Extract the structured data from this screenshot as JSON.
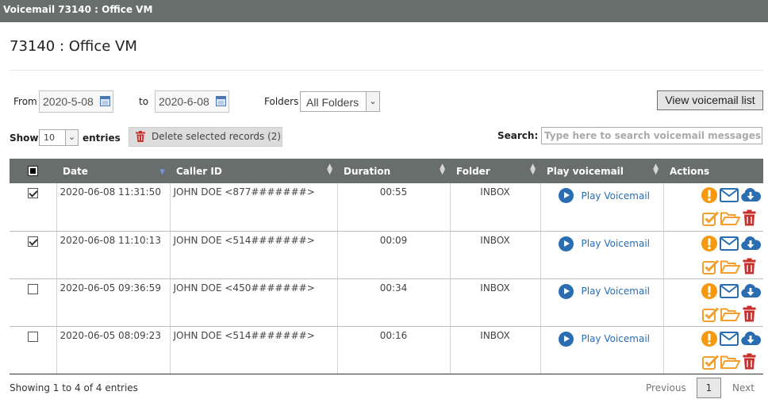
{
  "window": {
    "title": "Voicemail 73140 : Office VM"
  },
  "page": {
    "title": "73140 : Office VM"
  },
  "filters": {
    "from_label": "From",
    "from_value": "2020-5-08",
    "to_label": "to",
    "to_value": "2020-6-08",
    "folders_label": "Folders",
    "folders_value": "All Folders",
    "view_list_label": "View voicemail list"
  },
  "controls": {
    "show_label": "Show",
    "entries_count": "10",
    "entries_label": "entries",
    "delete_label": "Delete selected records (2)",
    "search_label": "Search:",
    "search_placeholder": "Type here to search voicemail messages"
  },
  "table": {
    "headers": [
      "Date",
      "Caller ID",
      "Duration",
      "Folder",
      "Play voicemail",
      "Actions"
    ],
    "rows": [
      {
        "checked": true,
        "date": "2020-06-08 11:31:50",
        "caller": "JOHN DOE <877#######>",
        "duration": "00:55",
        "folder": "INBOX",
        "play": "Play Voicemail"
      },
      {
        "checked": true,
        "date": "2020-06-08 11:10:13",
        "caller": "JOHN DOE <514#######>",
        "duration": "00:09",
        "folder": "INBOX",
        "play": "Play Voicemail"
      },
      {
        "checked": false,
        "date": "2020-06-05 09:36:59",
        "caller": "JOHN DOE <450#######>",
        "duration": "00:34",
        "folder": "INBOX",
        "play": "Play Voicemail"
      },
      {
        "checked": false,
        "date": "2020-06-05 08:09:23",
        "caller": "JOHN DOE <514#######>",
        "duration": "00:16",
        "folder": "INBOX",
        "play": "Play Voicemail"
      }
    ]
  },
  "footer": {
    "info": "Showing 1 to 4 of 4 entries",
    "previous": "Previous",
    "page": "1",
    "next": "Next"
  },
  "colors": {
    "header_bg": "#676e6c",
    "link_blue": "#2a6db1",
    "alert_orange": "#f59a10",
    "delete_red": "#c8302e",
    "action_blue": "#2a6db1",
    "check_orange": "#f0a030"
  },
  "icons": {
    "date_picker": "calendar-icon",
    "delete": "trash-icon",
    "play": "play-circle-icon",
    "actions": [
      "alert-icon",
      "envelope-icon",
      "cloud-download-icon",
      "checkbox-icon",
      "folder-open-icon",
      "trash-icon"
    ]
  }
}
